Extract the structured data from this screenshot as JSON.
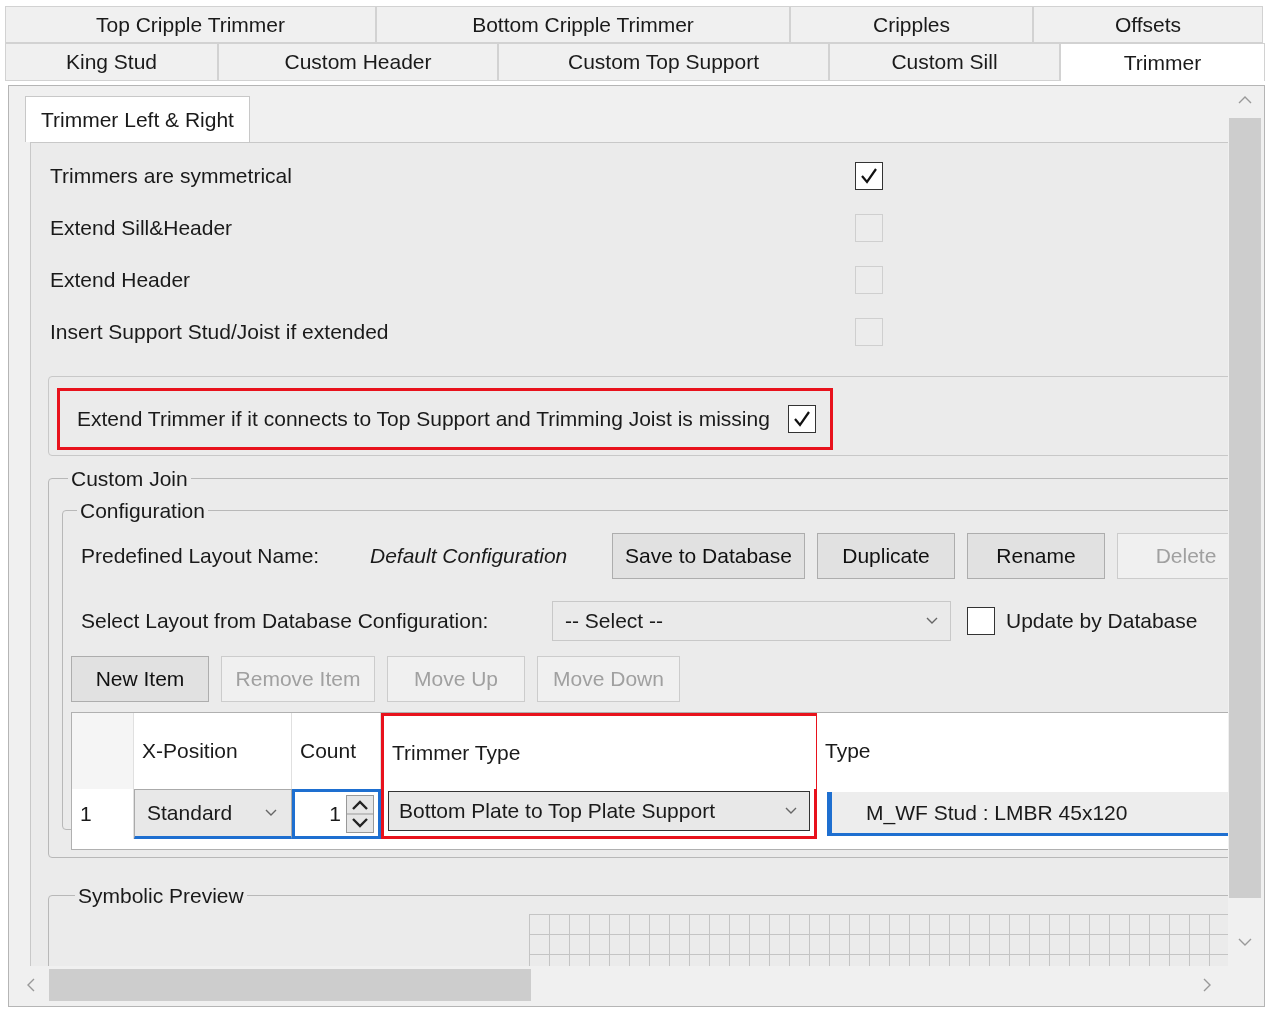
{
  "tabs_row_1": [
    {
      "label": "Top Cripple Trimmer",
      "selected": false
    },
    {
      "label": "Bottom Cripple Trimmer",
      "selected": false
    },
    {
      "label": "Cripples",
      "selected": false
    },
    {
      "label": "Offsets",
      "selected": false
    }
  ],
  "tabs_row_2": [
    {
      "label": "King Stud",
      "selected": false
    },
    {
      "label": "Custom Header",
      "selected": false
    },
    {
      "label": "Custom Top Support",
      "selected": false
    },
    {
      "label": "Custom Sill",
      "selected": false
    },
    {
      "label": "Trimmer",
      "selected": true
    }
  ],
  "sub_tabs": [
    {
      "label": "Trimmer Left & Right",
      "selected": true
    }
  ],
  "options": [
    {
      "label": "Trimmers are symmetrical",
      "checked": true,
      "disabled": false
    },
    {
      "label": "Extend Sill&Header",
      "checked": false,
      "disabled": true
    },
    {
      "label": "Extend Header",
      "checked": false,
      "disabled": true
    },
    {
      "label": "Insert Support Stud/Joist if extended",
      "checked": false,
      "disabled": true
    }
  ],
  "extend_trimmer": {
    "label": "Extend Trimmer if it connects to Top Support and Trimming Joist is missing",
    "checked": true,
    "highlighted": true
  },
  "custom_join": {
    "title": "Custom Join",
    "configuration": {
      "title": "Configuration",
      "layout_name_label": "Predefined Layout Name:",
      "layout_name_value": "Default Configuration",
      "buttons": [
        {
          "label": "Save to Database",
          "disabled": false
        },
        {
          "label": "Duplicate",
          "disabled": false
        },
        {
          "label": "Rename",
          "disabled": false
        },
        {
          "label": "Delete",
          "disabled": true
        }
      ],
      "select_label": "Select Layout from Database Configuration:",
      "select": {
        "value": "-- Select --"
      },
      "update_by_database": {
        "label": "Update by Database",
        "checked": false
      },
      "item_buttons": [
        {
          "label": "New Item",
          "disabled": false
        },
        {
          "label": "Remove Item",
          "disabled": true
        },
        {
          "label": "Move Up",
          "disabled": true
        },
        {
          "label": "Move Down",
          "disabled": true
        }
      ],
      "table": {
        "columns": [
          {
            "label": "X-Position",
            "highlighted": false
          },
          {
            "label": "Count",
            "highlighted": false
          },
          {
            "label": "Trimmer Type",
            "highlighted": true
          },
          {
            "label": "Type",
            "highlighted": false
          }
        ],
        "rows": [
          {
            "row_number": "1",
            "x_position": "Standard",
            "count": "1",
            "trimmer_type": "Bottom Plate to Top Plate Support",
            "type": "M_WF Stud : LMBR 45x120"
          }
        ]
      }
    }
  },
  "symbolic_preview": {
    "title": "Symbolic Preview"
  }
}
